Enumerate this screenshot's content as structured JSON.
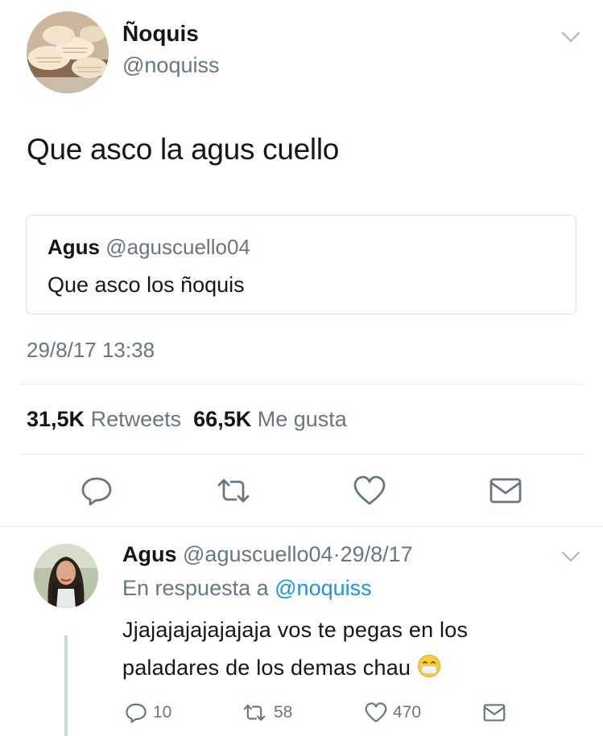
{
  "tweet": {
    "author_name": "Ñoquis",
    "author_handle": "@noquiss",
    "text": "Que asco la agus cuello",
    "quoted": {
      "name": "Agus",
      "handle": "@aguscuello04",
      "text": "Que asco los ñoquis"
    },
    "timestamp": "29/8/17 13:38",
    "stats": {
      "retweets_count": "31,5K",
      "retweets_label": "Retweets",
      "likes_count": "66,5K",
      "likes_label": "Me gusta"
    },
    "actions": [
      "reply-icon",
      "retweet-icon",
      "heart-icon",
      "mail-icon"
    ]
  },
  "reply": {
    "name": "Agus",
    "handle": "@aguscuello04",
    "separator": "·",
    "date": "29/8/17",
    "in_reply_prefix": "En respuesta a",
    "in_reply_handle": "@noquiss",
    "text_line1": "Jjajajajajajajaja vos te pegas en los",
    "text_line2": "paladares de los demas chau",
    "emoji": "mask-emoji",
    "counts": {
      "replies": "10",
      "retweets": "58",
      "likes": "470"
    }
  },
  "colors": {
    "text": "#14171a",
    "muted": "#657786",
    "link": "#1b95e0",
    "border": "#e1e8ed"
  }
}
